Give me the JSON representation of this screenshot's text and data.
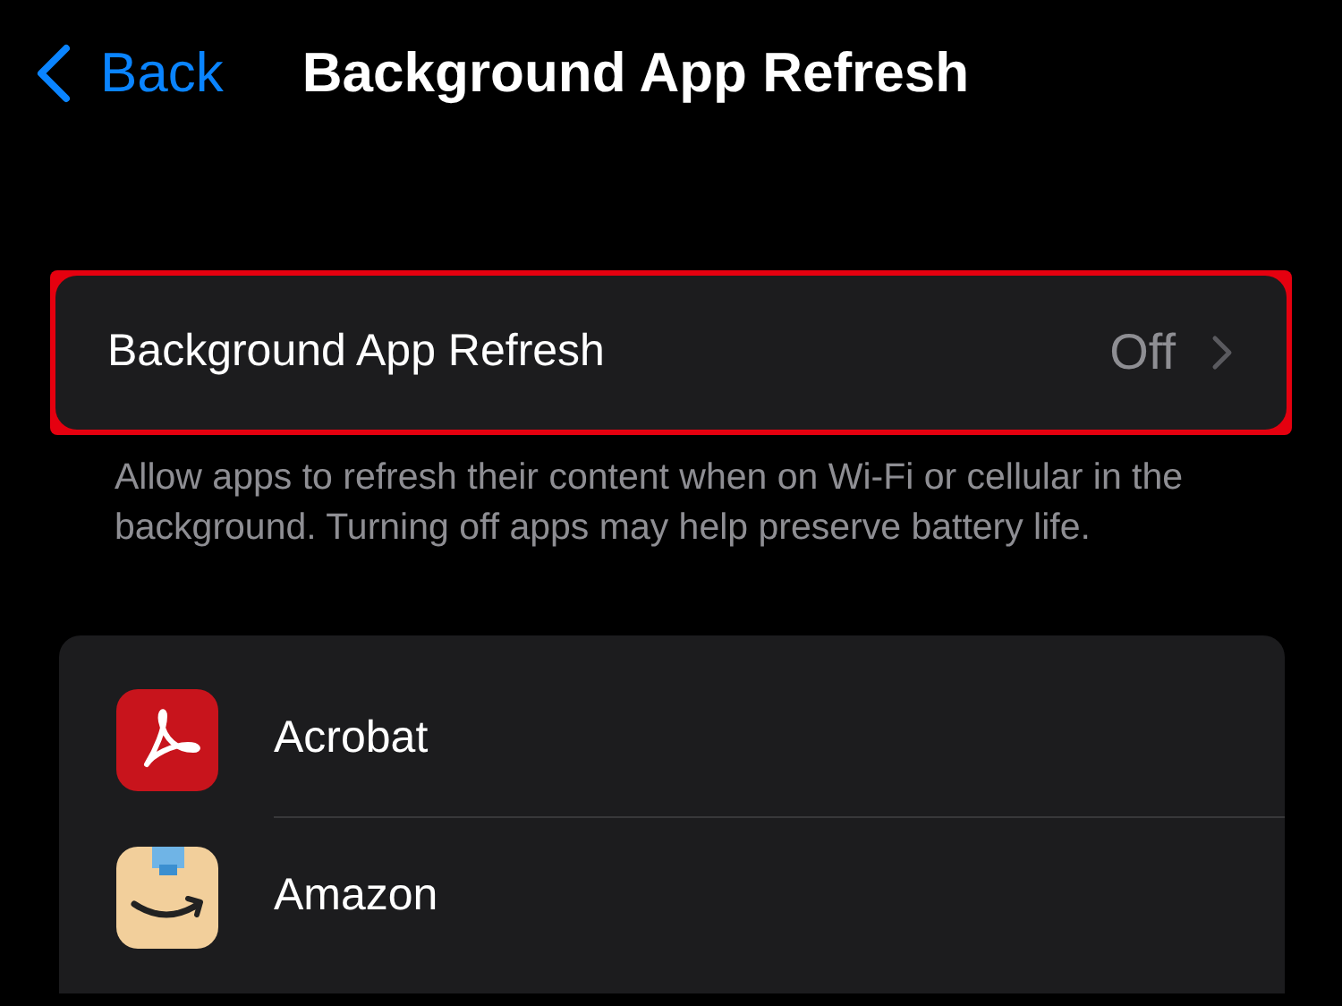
{
  "nav": {
    "back": "Back",
    "title": "Background App Refresh"
  },
  "setting": {
    "label": "Background App Refresh",
    "value": "Off",
    "highlighted": true
  },
  "footer": "Allow apps to refresh their content when on Wi-Fi or cellular in the background. Turning off apps may help preserve battery life.",
  "apps": [
    {
      "name": "Acrobat",
      "kind": "acrobat"
    },
    {
      "name": "Amazon",
      "kind": "amazon"
    }
  ]
}
